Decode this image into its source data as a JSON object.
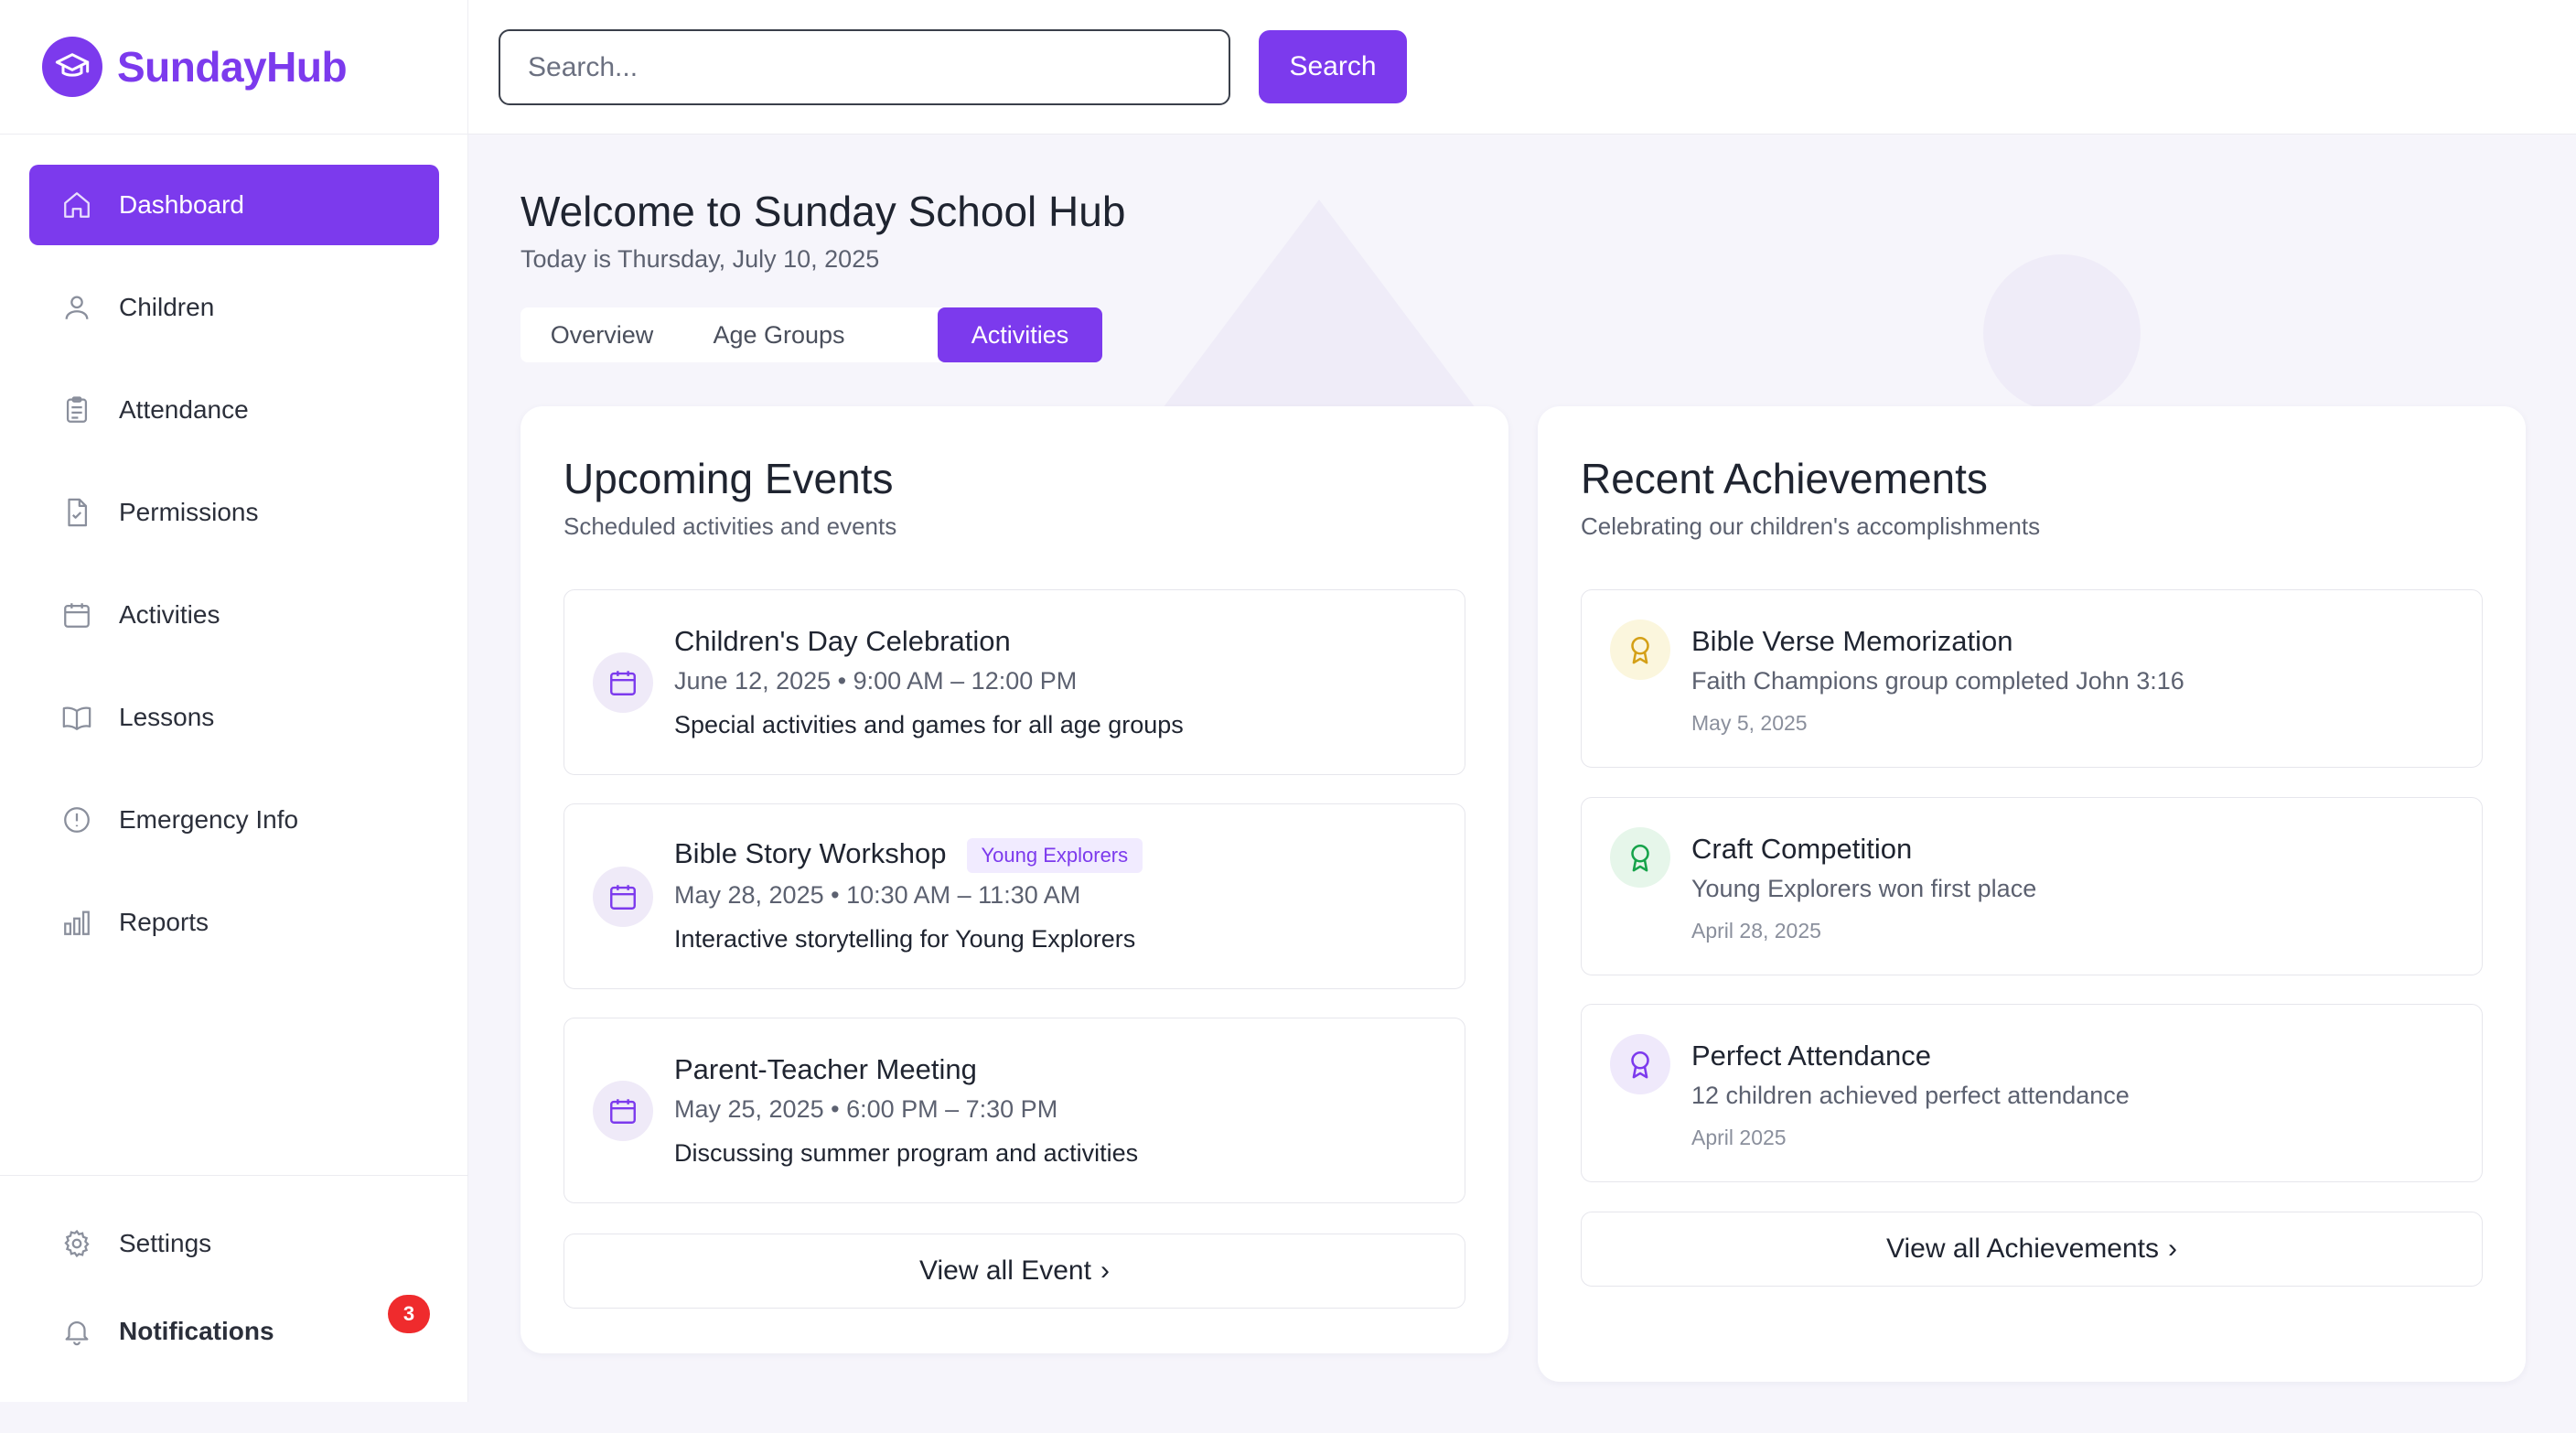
{
  "brand": {
    "name": "SundayHub"
  },
  "search": {
    "placeholder": "Search...",
    "button_label": "Search"
  },
  "sidebar": {
    "items": [
      {
        "label": "Dashboard",
        "icon": "home-icon",
        "active": true
      },
      {
        "label": "Children",
        "icon": "user-icon"
      },
      {
        "label": "Attendance",
        "icon": "clipboard-icon"
      },
      {
        "label": "Permissions",
        "icon": "file-check-icon"
      },
      {
        "label": "Activities",
        "icon": "calendar-icon"
      },
      {
        "label": "Lessons",
        "icon": "book-icon"
      },
      {
        "label": "Emergency Info",
        "icon": "alert-circle-icon"
      },
      {
        "label": "Reports",
        "icon": "bar-chart-icon"
      }
    ],
    "bottom": {
      "settings_label": "Settings",
      "notifications_label": "Notifications",
      "notifications_count": "3"
    }
  },
  "main": {
    "title": "Welcome to Sunday School Hub",
    "subtitle": "Today is Thursday, July 10, 2025",
    "tabs": [
      {
        "label": "Overview"
      },
      {
        "label": "Age Groups"
      },
      {
        "label": "Activities",
        "active": true
      }
    ]
  },
  "events": {
    "title": "Upcoming Events",
    "subtitle": "Scheduled activities and events",
    "items": [
      {
        "title": "Children's Day Celebration",
        "tag": "",
        "meta": "June 12, 2025 • 9:00 AM – 12:00 PM",
        "desc": "Special activities and games for all age groups"
      },
      {
        "title": "Bible Story Workshop",
        "tag": "Young Explorers",
        "meta": "May 28, 2025 • 10:30 AM – 11:30 AM",
        "desc": "Interactive storytelling for Young Explorers"
      },
      {
        "title": "Parent-Teacher Meeting",
        "tag": "",
        "meta": "May 25, 2025 • 6:00 PM – 7:30 PM",
        "desc": "Discussing summer program and activities"
      }
    ],
    "view_all": "View all Event"
  },
  "achievements": {
    "title": "Recent Achievements",
    "subtitle": "Celebrating our children's accomplishments",
    "items": [
      {
        "title": "Bible Verse Memorization",
        "desc": "Faith Champions group completed John 3:16",
        "date": "May 5, 2025",
        "icon_color": "#d4a017",
        "icon_bg": "#fbf6dd"
      },
      {
        "title": "Craft Competition",
        "desc": "Young Explorers won first place",
        "date": "April 28, 2025",
        "icon_color": "#16a34a",
        "icon_bg": "#e6f6ea"
      },
      {
        "title": "Perfect Attendance",
        "desc": "12 children achieved perfect attendance",
        "date": "April 2025",
        "icon_color": "#7c3aed",
        "icon_bg": "#efe9fb"
      }
    ],
    "view_all": "View all Achievements"
  },
  "colors": {
    "accent": "#7c3aed",
    "badge": "#ef2b2d",
    "background": "#f6f5fb"
  }
}
